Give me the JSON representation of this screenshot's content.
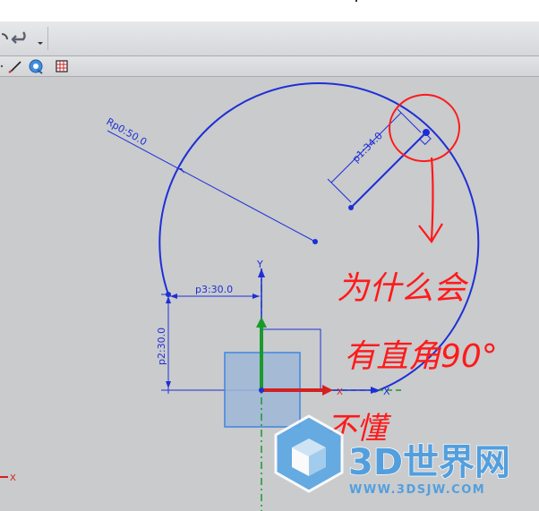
{
  "toolbar": {
    "undo_icon": "undo-icon",
    "dropdown_icon": "dropdown-arrow-icon",
    "line_tool_icon": "line-tool-icon",
    "view_tool_icon": "view-orient-icon",
    "grid_tool_icon": "grid-icon"
  },
  "sketch": {
    "radius_label": "Rp0:50.0",
    "diag_label": "p1:34.0",
    "horiz_label": "p3:30.0",
    "vert_label": "p2:30.0",
    "axis_y": "Y",
    "axis_x": "X",
    "axis_x2": "X",
    "triad_x": "X"
  },
  "annotation": {
    "line1": "为什么会",
    "line2": "有直角90°",
    "line3": "不懂"
  },
  "watermark": {
    "title": "3D世界网",
    "url": "WWW.3DSJW.COM"
  },
  "colors": {
    "sketch_blue": "#1f2fd6",
    "ink_red": "#ff1a1a",
    "axis_green": "#1a9a2a",
    "axis_red": "#d32020"
  }
}
